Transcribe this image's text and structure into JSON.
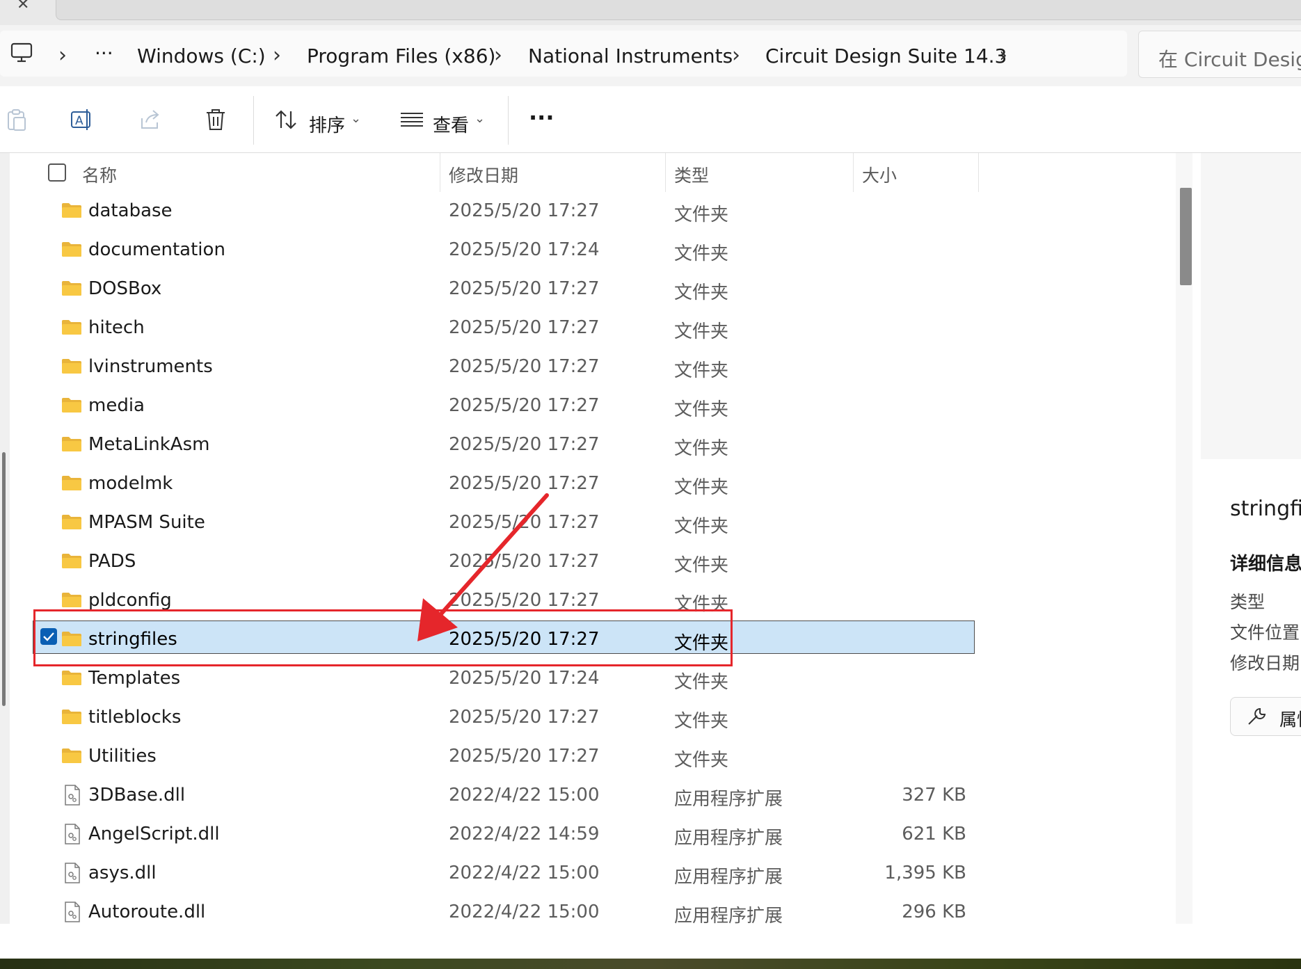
{
  "address_bar": {
    "breadcrumbs": [
      "Windows (C:)",
      "Program Files (x86)",
      "National Instruments",
      "Circuit Design Suite 14.3"
    ],
    "overflow": "···",
    "search_placeholder": "在 Circuit Design"
  },
  "toolbar": {
    "sort_label": "排序",
    "view_label": "查看",
    "more_label": "···"
  },
  "columns": {
    "name": "名称",
    "modified": "修改日期",
    "type": "类型",
    "size": "大小"
  },
  "files": [
    {
      "name": "database",
      "modified": "2025/5/20 17:27",
      "type": "文件夹",
      "size": "",
      "kind": "folder"
    },
    {
      "name": "documentation",
      "modified": "2025/5/20 17:24",
      "type": "文件夹",
      "size": "",
      "kind": "folder"
    },
    {
      "name": "DOSBox",
      "modified": "2025/5/20 17:27",
      "type": "文件夹",
      "size": "",
      "kind": "folder"
    },
    {
      "name": "hitech",
      "modified": "2025/5/20 17:27",
      "type": "文件夹",
      "size": "",
      "kind": "folder"
    },
    {
      "name": "lvinstruments",
      "modified": "2025/5/20 17:27",
      "type": "文件夹",
      "size": "",
      "kind": "folder"
    },
    {
      "name": "media",
      "modified": "2025/5/20 17:27",
      "type": "文件夹",
      "size": "",
      "kind": "folder"
    },
    {
      "name": "MetaLinkAsm",
      "modified": "2025/5/20 17:27",
      "type": "文件夹",
      "size": "",
      "kind": "folder"
    },
    {
      "name": "modelmk",
      "modified": "2025/5/20 17:27",
      "type": "文件夹",
      "size": "",
      "kind": "folder"
    },
    {
      "name": "MPASM Suite",
      "modified": "2025/5/20 17:27",
      "type": "文件夹",
      "size": "",
      "kind": "folder"
    },
    {
      "name": "PADS",
      "modified": "2025/5/20 17:27",
      "type": "文件夹",
      "size": "",
      "kind": "folder"
    },
    {
      "name": "pldconfig",
      "modified": "2025/5/20 17:27",
      "type": "文件夹",
      "size": "",
      "kind": "folder"
    },
    {
      "name": "stringfiles",
      "modified": "2025/5/20 17:27",
      "type": "文件夹",
      "size": "",
      "kind": "folder",
      "selected": true
    },
    {
      "name": "Templates",
      "modified": "2025/5/20 17:24",
      "type": "文件夹",
      "size": "",
      "kind": "folder"
    },
    {
      "name": "titleblocks",
      "modified": "2025/5/20 17:27",
      "type": "文件夹",
      "size": "",
      "kind": "folder"
    },
    {
      "name": "Utilities",
      "modified": "2025/5/20 17:27",
      "type": "文件夹",
      "size": "",
      "kind": "folder"
    },
    {
      "name": "3DBase.dll",
      "modified": "2022/4/22 15:00",
      "type": "应用程序扩展",
      "size": "327 KB",
      "kind": "dll"
    },
    {
      "name": "AngelScript.dll",
      "modified": "2022/4/22 14:59",
      "type": "应用程序扩展",
      "size": "621 KB",
      "kind": "dll"
    },
    {
      "name": "asys.dll",
      "modified": "2022/4/22 15:00",
      "type": "应用程序扩展",
      "size": "1,395 KB",
      "kind": "dll"
    },
    {
      "name": "Autoroute.dll",
      "modified": "2022/4/22 15:00",
      "type": "应用程序扩展",
      "size": "296 KB",
      "kind": "dll"
    }
  ],
  "details_pane": {
    "filename": "stringfi",
    "heading": "详细信息",
    "labels": [
      "类型",
      "文件位置",
      "修改日期"
    ],
    "properties_button": "属性"
  },
  "colors": {
    "selection": "#cce4f7",
    "checkbox_accent": "#0a5fb4",
    "annotation": "#e5262b",
    "folder": "#f8c843"
  },
  "icons": {
    "computer": "computer-icon",
    "copy": "paste-icon",
    "rename": "rename-icon",
    "share": "share-icon",
    "delete": "trash-icon",
    "sort": "sort-arrows-icon",
    "view": "list-view-icon",
    "folder": "folder-icon",
    "dll": "dll-file-icon",
    "properties": "wrench-icon"
  }
}
